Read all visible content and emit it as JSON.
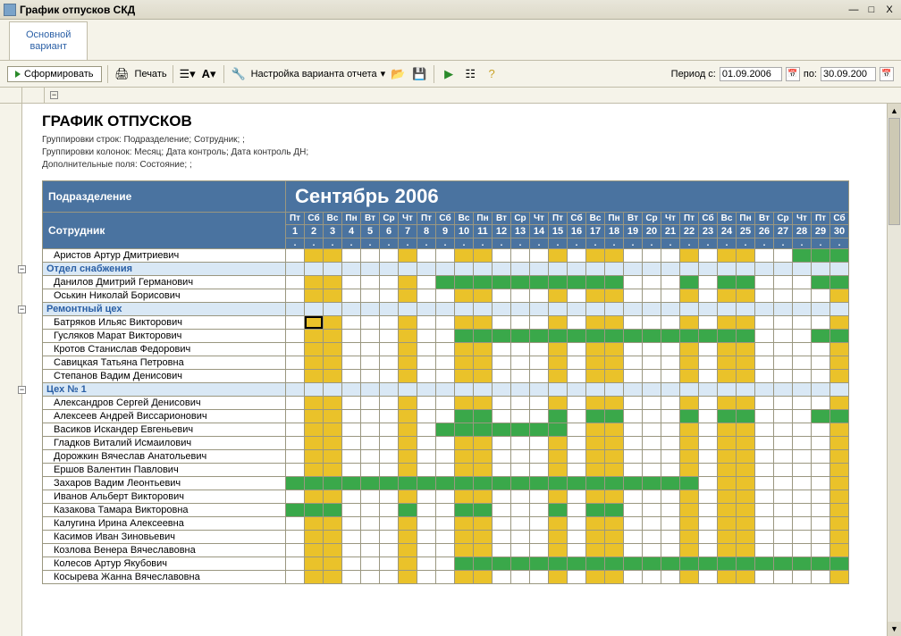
{
  "window": {
    "title": "График отпусков СКД"
  },
  "tab": {
    "label": "Основной\nвариант"
  },
  "toolbar": {
    "generate": "Сформировать",
    "print": "Печать",
    "settings": "Настройка варианта отчета",
    "period_label": "Период с:",
    "period_from": "01.09.2006",
    "period_to_label": "по:",
    "period_to": "30.09.200"
  },
  "report": {
    "title": "ГРАФИК ОТПУСКОВ",
    "meta1": "Группировки строк: Подразделение; Сотрудник;  ;",
    "meta2": "Группировки колонок: Месяц; Дата контроль; Дата контроль ДН;",
    "meta3": "Дополнительные поля: Состояние;  ;",
    "hdr_dept": "Подразделение",
    "hdr_emp": "Сотрудник",
    "month": "Сентябрь 2006",
    "dow": [
      "Пт",
      "Сб",
      "Вс",
      "Пн",
      "Вт",
      "Ср",
      "Чт",
      "Пт",
      "Сб",
      "Вс",
      "Пн",
      "Вт",
      "Ср",
      "Чт",
      "Пт",
      "Сб",
      "Вс",
      "Пн",
      "Вт",
      "Ср",
      "Чт",
      "Пт",
      "Сб",
      "Вс",
      "Пн",
      "Вт",
      "Ср",
      "Чт",
      "Пт",
      "Сб"
    ],
    "days": [
      "1",
      "2",
      "3",
      "4",
      "5",
      "6",
      "7",
      "8",
      "9",
      "10",
      "11",
      "12",
      "13",
      "14",
      "15",
      "16",
      "17",
      "18",
      "19",
      "20",
      "21",
      "22",
      "23",
      "24",
      "25",
      "26",
      "27",
      "28",
      "29",
      "30"
    ]
  },
  "rows": [
    {
      "t": "emp",
      "name": "Аристов Артур Дмитриевич",
      "cells": "-yy---y--yy---y-yy---y-yy--gggg"
    },
    {
      "t": "grp",
      "name": "Отдел снабжения"
    },
    {
      "t": "emp",
      "name": "Данилов Дмитрий Германович",
      "cells": "-yy---y-gggggggggg---g-gg---ggy"
    },
    {
      "t": "emp",
      "name": "Оськин Николай Борисович",
      "cells": "-yy---y--yy---y-yy---y-yy----yy"
    },
    {
      "t": "grp",
      "name": "Ремонтный цех"
    },
    {
      "t": "emp",
      "name": "Батряков Ильяс Викторович",
      "cells": "-Yy---y--yy---y-yy---y-yy----yy"
    },
    {
      "t": "emp",
      "name": "Гусляков Марат Викторович",
      "cells": "-yy---y--gggggggggggggggg---ggy"
    },
    {
      "t": "emp",
      "name": "Кротов Станислав Федорович",
      "cells": "-yy---y--yy---y-yy---y-yy----yy"
    },
    {
      "t": "emp",
      "name": "Савицкая Татьяна Петровна",
      "cells": "-yy---y--yy---y-yy---y-yy----yy"
    },
    {
      "t": "emp",
      "name": "Степанов Вадим Денисович",
      "cells": "-yy---y--yy---y-yy---y-yy----yy"
    },
    {
      "t": "grp",
      "name": "Цех № 1"
    },
    {
      "t": "emp",
      "name": "Александров Сергей Денисович",
      "cells": "-yy---y--yy---y-yy---y-yy----yy"
    },
    {
      "t": "emp",
      "name": "Алексеев Андрей Виссарионович",
      "cells": "-yy---y--gg---g-gg---g-gg---ggy"
    },
    {
      "t": "emp",
      "name": "Васиков Искандер Евгеньевич",
      "cells": "-yy---y-ggggggg-yy---y-yy----yy"
    },
    {
      "t": "emp",
      "name": "Гладков Виталий Исмаилович",
      "cells": "-yy---y--yy---y-yy---y-yy----yy"
    },
    {
      "t": "emp",
      "name": "Дорожкин Вячеслав Анатольевич",
      "cells": "-yy---y--yy---y-yy---y-yy----yy"
    },
    {
      "t": "emp",
      "name": "Ершов Валентин Павлович",
      "cells": "-yy---y--yy---y-yy---y-yy----yy"
    },
    {
      "t": "emp",
      "name": "Захаров Вадим Леонтьевич",
      "cells": "gggggggggggggggggggggg-yy----yy"
    },
    {
      "t": "emp",
      "name": "Иванов Альберт Викторович",
      "cells": "-yy---y--yy---y-yy---y-yy----yy"
    },
    {
      "t": "emp",
      "name": "Казакова Тамара Викторовна",
      "cells": "ggg---g--gg---g-gg---y-yy----yy"
    },
    {
      "t": "emp",
      "name": "Калугина Ирина Алексеевна",
      "cells": "-yy---y--yy---y-yy---y-yy----yy"
    },
    {
      "t": "emp",
      "name": "Касимов Иван Зиновьевич",
      "cells": "-yy---y--yy---y-yy---y-yy----yy"
    },
    {
      "t": "emp",
      "name": "Козлова Венера Вячеславовна",
      "cells": "-yy---y--yy---y-yy---y-yy----yy"
    },
    {
      "t": "emp",
      "name": "Колесов Артур Якубович",
      "cells": "-yy---y--gggggggggggggggggggggy"
    },
    {
      "t": "emp",
      "name": "Косырева Жанна Вячеславовна",
      "cells": "-yy---y--yy---y-yy---y-yy----yy"
    }
  ]
}
